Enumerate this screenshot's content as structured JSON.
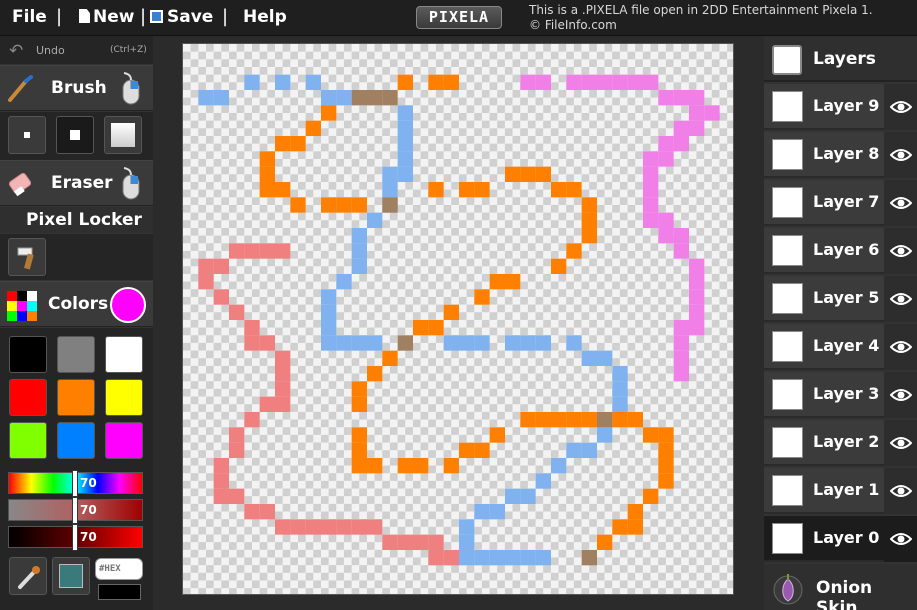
{
  "menu": {
    "file": "File",
    "new": "New",
    "save": "Save",
    "help": "Help",
    "separator": "|"
  },
  "logo": "PIXELA",
  "notice": {
    "line1": "This is a .PIXELA file open in 2DD Entertainment Pixela 1.",
    "line2": "© FileInfo.com"
  },
  "tools": {
    "undo_label": "Undo",
    "undo_shortcut": "(Ctrl+Z)",
    "brush_label": "Brush",
    "eraser_label": "Eraser",
    "pixel_locker_label": "Pixel Locker",
    "colors_label": "Colors",
    "current_color": "#ff00ff",
    "hex_placeholder": "#HEX"
  },
  "palette": [
    "#000000",
    "#808080",
    "#ffffff",
    "#ff0000",
    "#ff8000",
    "#ffff00",
    "#80ff00",
    "#0080ff",
    "#ff00ff"
  ],
  "sliders": [
    {
      "name": "hue",
      "value": "70"
    },
    {
      "name": "saturation",
      "value": "70"
    },
    {
      "name": "value",
      "value": "70"
    }
  ],
  "layers_panel": {
    "title": "Layers",
    "onion_skin": "Onion Skin",
    "layers": [
      {
        "label": "Layer 9",
        "active": false
      },
      {
        "label": "Layer 8",
        "active": false
      },
      {
        "label": "Layer 7",
        "active": false
      },
      {
        "label": "Layer 6",
        "active": false
      },
      {
        "label": "Layer 5",
        "active": false
      },
      {
        "label": "Layer 4",
        "active": false
      },
      {
        "label": "Layer 3",
        "active": false
      },
      {
        "label": "Layer 2",
        "active": false
      },
      {
        "label": "Layer 1",
        "active": false
      },
      {
        "label": "Layer 0",
        "active": true
      }
    ]
  },
  "canvas": {
    "grid_size": 36,
    "colors": {
      "orange": "#ff7f00",
      "blue": "#7fb2ee",
      "pink": "#f07f7f",
      "magenta": "#f080e8",
      "brown": "#a08060"
    },
    "pixels": {
      "blue": [
        [
          1,
          3
        ],
        [
          2,
          3
        ],
        [
          4,
          2
        ],
        [
          6,
          2
        ],
        [
          8,
          2
        ],
        [
          9,
          3
        ],
        [
          10,
          3
        ],
        [
          14,
          4
        ],
        [
          14,
          5
        ],
        [
          14,
          6
        ],
        [
          14,
          7
        ],
        [
          14,
          8
        ],
        [
          13,
          8
        ],
        [
          13,
          9
        ],
        [
          13,
          10
        ],
        [
          12,
          11
        ],
        [
          11,
          12
        ],
        [
          11,
          13
        ],
        [
          11,
          14
        ],
        [
          10,
          15
        ],
        [
          9,
          16
        ],
        [
          9,
          17
        ],
        [
          9,
          18
        ],
        [
          9,
          19
        ],
        [
          10,
          19
        ],
        [
          11,
          19
        ],
        [
          12,
          19
        ],
        [
          17,
          19
        ],
        [
          18,
          19
        ],
        [
          19,
          19
        ],
        [
          21,
          19
        ],
        [
          22,
          19
        ],
        [
          23,
          19
        ],
        [
          25,
          19
        ],
        [
          26,
          20
        ],
        [
          27,
          20
        ],
        [
          28,
          21
        ],
        [
          28,
          22
        ],
        [
          28,
          23
        ],
        [
          27,
          25
        ],
        [
          26,
          26
        ],
        [
          25,
          26
        ],
        [
          24,
          27
        ],
        [
          23,
          28
        ],
        [
          22,
          29
        ],
        [
          21,
          29
        ],
        [
          20,
          30
        ],
        [
          19,
          30
        ],
        [
          18,
          31
        ],
        [
          18,
          32
        ],
        [
          18,
          33
        ],
        [
          19,
          33
        ],
        [
          20,
          33
        ],
        [
          21,
          33
        ],
        [
          22,
          33
        ],
        [
          23,
          33
        ]
      ],
      "orange": [
        [
          14,
          2
        ],
        [
          16,
          2
        ],
        [
          17,
          2
        ],
        [
          9,
          4
        ],
        [
          8,
          5
        ],
        [
          7,
          6
        ],
        [
          6,
          6
        ],
        [
          5,
          7
        ],
        [
          5,
          8
        ],
        [
          5,
          9
        ],
        [
          6,
          9
        ],
        [
          7,
          10
        ],
        [
          9,
          10
        ],
        [
          10,
          10
        ],
        [
          11,
          10
        ],
        [
          16,
          9
        ],
        [
          18,
          9
        ],
        [
          19,
          9
        ],
        [
          21,
          8
        ],
        [
          22,
          8
        ],
        [
          23,
          8
        ],
        [
          24,
          9
        ],
        [
          25,
          9
        ],
        [
          26,
          10
        ],
        [
          26,
          11
        ],
        [
          26,
          12
        ],
        [
          25,
          13
        ],
        [
          24,
          14
        ],
        [
          21,
          15
        ],
        [
          20,
          15
        ],
        [
          19,
          16
        ],
        [
          17,
          17
        ],
        [
          16,
          18
        ],
        [
          15,
          18
        ],
        [
          13,
          20
        ],
        [
          12,
          21
        ],
        [
          11,
          22
        ],
        [
          11,
          23
        ],
        [
          11,
          25
        ],
        [
          11,
          26
        ],
        [
          11,
          27
        ],
        [
          12,
          27
        ],
        [
          14,
          27
        ],
        [
          15,
          27
        ],
        [
          17,
          27
        ],
        [
          18,
          26
        ],
        [
          19,
          26
        ],
        [
          20,
          25
        ],
        [
          22,
          24
        ],
        [
          23,
          24
        ],
        [
          24,
          24
        ],
        [
          25,
          24
        ],
        [
          26,
          24
        ],
        [
          28,
          24
        ],
        [
          29,
          24
        ],
        [
          30,
          25
        ],
        [
          31,
          25
        ],
        [
          31,
          26
        ],
        [
          31,
          27
        ],
        [
          31,
          28
        ],
        [
          30,
          29
        ],
        [
          29,
          30
        ],
        [
          29,
          31
        ],
        [
          28,
          31
        ],
        [
          27,
          32
        ]
      ],
      "pink": [
        [
          3,
          13
        ],
        [
          4,
          13
        ],
        [
          5,
          13
        ],
        [
          6,
          13
        ],
        [
          1,
          14
        ],
        [
          2,
          14
        ],
        [
          1,
          15
        ],
        [
          2,
          16
        ],
        [
          3,
          17
        ],
        [
          4,
          18
        ],
        [
          4,
          19
        ],
        [
          5,
          19
        ],
        [
          6,
          20
        ],
        [
          6,
          21
        ],
        [
          6,
          22
        ],
        [
          6,
          23
        ],
        [
          5,
          23
        ],
        [
          4,
          24
        ],
        [
          3,
          25
        ],
        [
          3,
          26
        ],
        [
          2,
          27
        ],
        [
          2,
          28
        ],
        [
          2,
          29
        ],
        [
          3,
          29
        ],
        [
          4,
          30
        ],
        [
          5,
          30
        ],
        [
          6,
          31
        ],
        [
          7,
          31
        ],
        [
          8,
          31
        ],
        [
          9,
          31
        ],
        [
          10,
          31
        ],
        [
          11,
          31
        ],
        [
          12,
          31
        ],
        [
          13,
          32
        ],
        [
          14,
          32
        ],
        [
          15,
          32
        ],
        [
          16,
          32
        ],
        [
          16,
          33
        ],
        [
          17,
          33
        ]
      ],
      "magenta": [
        [
          22,
          2
        ],
        [
          23,
          2
        ],
        [
          25,
          2
        ],
        [
          26,
          2
        ],
        [
          27,
          2
        ],
        [
          28,
          2
        ],
        [
          29,
          2
        ],
        [
          30,
          2
        ],
        [
          31,
          3
        ],
        [
          32,
          3
        ],
        [
          33,
          3
        ],
        [
          33,
          4
        ],
        [
          34,
          4
        ],
        [
          33,
          5
        ],
        [
          32,
          5
        ],
        [
          32,
          6
        ],
        [
          31,
          6
        ],
        [
          31,
          7
        ],
        [
          30,
          7
        ],
        [
          30,
          8
        ],
        [
          30,
          9
        ],
        [
          30,
          10
        ],
        [
          30,
          11
        ],
        [
          31,
          11
        ],
        [
          31,
          12
        ],
        [
          32,
          12
        ],
        [
          32,
          13
        ],
        [
          33,
          14
        ],
        [
          33,
          15
        ],
        [
          33,
          16
        ],
        [
          33,
          17
        ],
        [
          33,
          18
        ],
        [
          32,
          18
        ],
        [
          32,
          19
        ],
        [
          32,
          20
        ],
        [
          32,
          21
        ]
      ],
      "brown": [
        [
          11,
          3
        ],
        [
          12,
          3
        ],
        [
          13,
          3
        ],
        [
          13,
          10
        ],
        [
          14,
          19
        ],
        [
          27,
          24
        ],
        [
          26,
          33
        ]
      ]
    }
  }
}
